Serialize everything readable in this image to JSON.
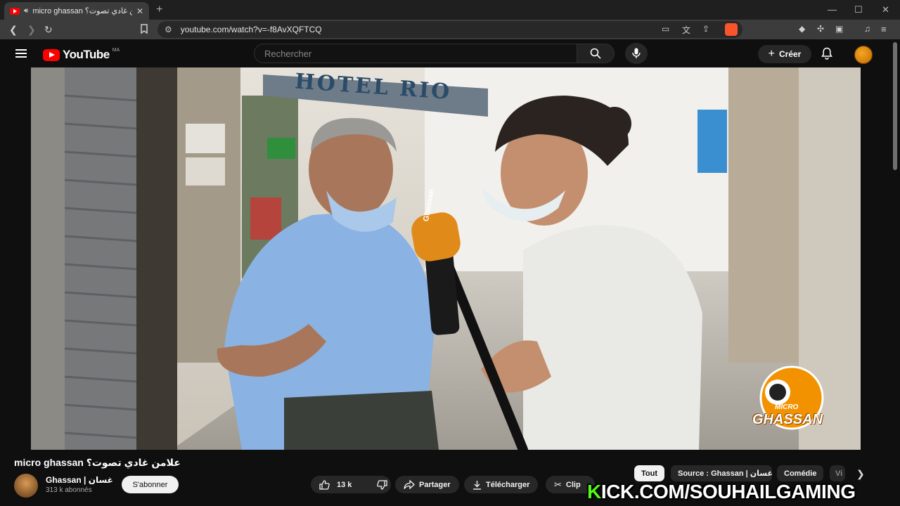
{
  "browser": {
    "tab_title": "micro ghassan علامن غادي تصوت؟",
    "url": "youtube.com/watch?v=-f8AvXQFTCQ"
  },
  "youtube": {
    "logo_text": "YouTube",
    "country_code": "MA",
    "search_placeholder": "Rechercher",
    "create_label": "Créer"
  },
  "video": {
    "title": "micro ghassan علامن غادي تصوت؟",
    "sign_text": "HOTEL RIO",
    "mic_text": "Ghassan",
    "watermark_top": "MICRO",
    "watermark_bottom": "GHASSAN"
  },
  "channel": {
    "name": "Ghassan | غسان",
    "subscribers": "313 k abonnés",
    "subscribe_label": "S'abonner"
  },
  "actions": {
    "likes": "13 k",
    "share_label": "Partager",
    "download_label": "Télécharger",
    "clip_label": "Clip"
  },
  "chips": [
    {
      "label": "Tout"
    },
    {
      "label": "Source : Ghassan | غسان"
    },
    {
      "label": "Comédie"
    },
    {
      "label": "Vi"
    }
  ],
  "overlay": {
    "k": "K",
    "rest": "ICK.COM/SOUHAILGAMING"
  },
  "colors": {
    "yt_red": "#ff0000",
    "kick_green": "#53fc18",
    "watermark_orange": "#f39200"
  }
}
